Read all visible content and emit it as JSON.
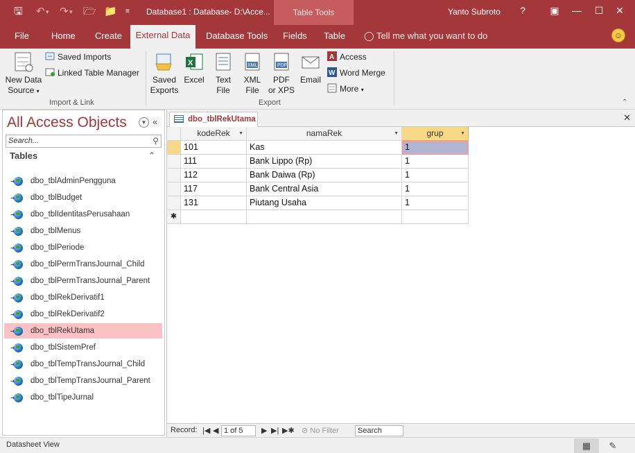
{
  "titlebar": {
    "doc_title": "Database1 : Database- D:\\Acce...",
    "context_group": "Table Tools",
    "user": "Yanto Subroto",
    "help": "?",
    "icons": [
      "save-icon",
      "undo-icon",
      "redo-icon",
      "open-folder-icon",
      "new-db-icon",
      "customize-qat-icon"
    ]
  },
  "tabs": [
    "File",
    "Home",
    "Create",
    "External Data",
    "Database Tools",
    "Fields",
    "Table"
  ],
  "active_tab": "External Data",
  "tell_me": "Tell me what you want to do",
  "ribbon": {
    "import": {
      "new_source_1": "New Data",
      "new_source_2": "Source",
      "saved_imports": "Saved Imports",
      "linked_manager": "Linked Table Manager",
      "group": "Import & Link"
    },
    "export": {
      "saved_exports_1": "Saved",
      "saved_exports_2": "Exports",
      "excel": "Excel",
      "text_1": "Text",
      "text_2": "File",
      "xml_1": "XML",
      "xml_2": "File",
      "pdf_1": "PDF",
      "pdf_2": "or XPS",
      "email": "Email",
      "access": "Access",
      "word_merge": "Word Merge",
      "more": "More",
      "group": "Export"
    }
  },
  "nav": {
    "title": "All Access Objects",
    "search_placeholder": "Search...",
    "section": "Tables",
    "items": [
      {
        "label": "dbo_tblAdminPengguna",
        "selected": false
      },
      {
        "label": "dbo_tblBudget",
        "selected": false
      },
      {
        "label": "dbo_tblIdentitasPerusahaan",
        "selected": false
      },
      {
        "label": "dbo_tblMenus",
        "selected": false
      },
      {
        "label": "dbo_tblPeriode",
        "selected": false
      },
      {
        "label": "dbo_tblPermTransJournal_Child",
        "selected": false
      },
      {
        "label": "dbo_tblPermTransJournal_Parent",
        "selected": false
      },
      {
        "label": "dbo_tblRekDerivatif1",
        "selected": false
      },
      {
        "label": "dbo_tblRekDerivatif2",
        "selected": false
      },
      {
        "label": "dbo_tblRekUtama",
        "selected": true
      },
      {
        "label": "dbo_tblSistemPref",
        "selected": false
      },
      {
        "label": "dbo_tblTempTransJournal_Child",
        "selected": false
      },
      {
        "label": "dbo_tblTempTransJournal_Parent",
        "selected": false
      },
      {
        "label": "dbo_tblTipeJurnal",
        "selected": false
      }
    ]
  },
  "document": {
    "tab_title": "dbo_tblRekUtama",
    "columns": [
      "kodeRek",
      "namaRek",
      "grup"
    ],
    "rows": [
      [
        "101",
        "Kas",
        "1"
      ],
      [
        "111",
        "Bank Lippo (Rp)",
        "1"
      ],
      [
        "112",
        "Bank Daiwa (Rp)",
        "1"
      ],
      [
        "117",
        "Bank Central Asia",
        "1"
      ],
      [
        "131",
        "Piutang Usaha",
        "1"
      ]
    ],
    "new_row_marker": "✱"
  },
  "record_nav": {
    "label": "Record:",
    "position": "1 of 5",
    "filter": "No Filter",
    "search": "Search"
  },
  "status": {
    "text": "Datasheet View",
    "views": [
      "datasheet-view-icon",
      "design-view-icon"
    ]
  }
}
